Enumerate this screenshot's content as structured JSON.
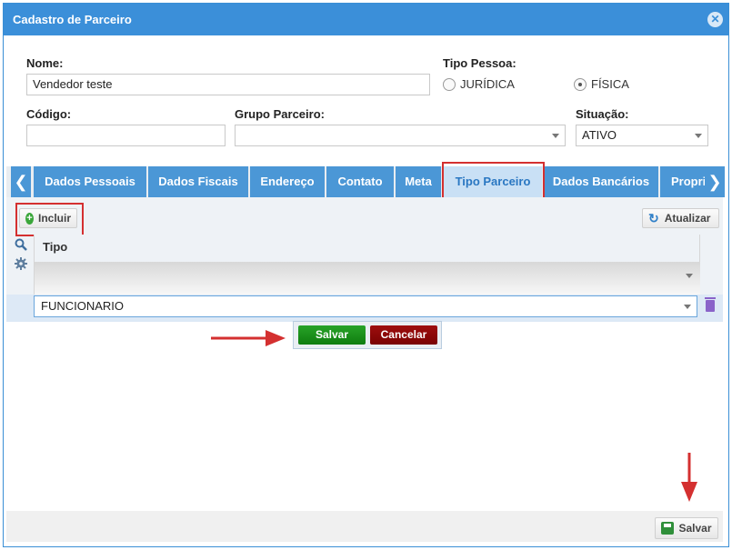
{
  "dialog": {
    "title": "Cadastro de Parceiro",
    "close_icon": "close-icon"
  },
  "form": {
    "nome_label": "Nome:",
    "nome_value": "Vendedor teste",
    "tipo_pessoa_label": "Tipo Pessoa:",
    "tipo_pessoa_options": [
      "JURÍDICA",
      "FÍSICA"
    ],
    "tipo_pessoa_selected": "FÍSICA",
    "codigo_label": "Código:",
    "codigo_value": "",
    "grupo_label": "Grupo Parceiro:",
    "grupo_value": "",
    "situacao_label": "Situação:",
    "situacao_value": "ATIVO"
  },
  "tabs": {
    "items": [
      "Dados Pessoais",
      "Dados Fiscais",
      "Endereço",
      "Contato",
      "Meta",
      "Tipo Parceiro",
      "Dados Bancários",
      "Propri"
    ],
    "active": "Tipo Parceiro"
  },
  "toolbar": {
    "incluir_label": "Incluir",
    "atualizar_label": "Atualizar"
  },
  "grid": {
    "column_header": "Tipo",
    "rows": [
      {
        "tipo": "FUNCIONARIO"
      }
    ]
  },
  "row_editor": {
    "save_label": "Salvar",
    "cancel_label": "Cancelar"
  },
  "footer": {
    "save_label": "Salvar"
  },
  "colors": {
    "accent": "#3b8fd9",
    "annotation": "#d43030",
    "save_green": "#1a8f1a",
    "cancel_red": "#8a0505"
  }
}
